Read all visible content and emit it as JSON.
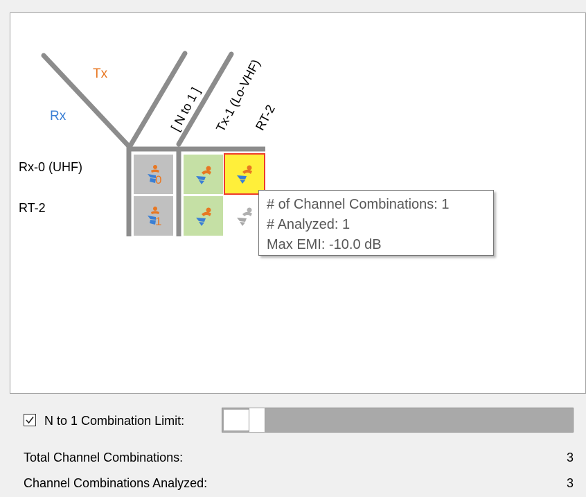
{
  "matrix": {
    "tx_axis_label": "Tx",
    "rx_axis_label": "Rx",
    "columns": [
      {
        "label": "[ N to 1 ]"
      },
      {
        "label": "Tx-1 (Lo-VHF)"
      },
      {
        "label": "RT-2"
      }
    ],
    "rows": [
      {
        "label": "Rx-0 (UHF)",
        "n_to_1_value": "0"
      },
      {
        "label": "RT-2",
        "n_to_1_value": "1"
      }
    ],
    "cell_states": [
      [
        "gray",
        "green",
        "yellow-selected"
      ],
      [
        "gray",
        "green",
        "disabled"
      ]
    ],
    "colors": {
      "tx": "#e87722",
      "rx": "#3a7fd5",
      "n_to_1_cell": "#c0c0c0",
      "analyzed_cell": "#c5e0a5",
      "selected_cell": "#ffef3a",
      "selected_border": "#ee3b2b"
    }
  },
  "tooltip": {
    "line1": "# of Channel Combinations: 1",
    "line2": "# Analyzed: 1",
    "line3": "Max EMI: -10.0 dB"
  },
  "controls": {
    "limit_checked": true,
    "limit_label": "N to 1 Combination Limit:",
    "limit_slider_fraction": 0.1
  },
  "stats": {
    "total_label": "Total Channel Combinations:",
    "total_value": "3",
    "analyzed_label": "Channel Combinations Analyzed:",
    "analyzed_value": "3"
  }
}
